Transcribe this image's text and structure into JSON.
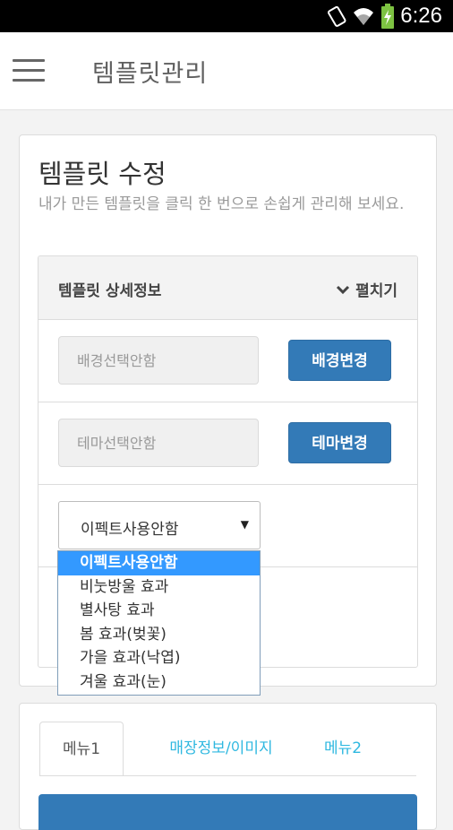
{
  "status_bar": {
    "time": "6:26",
    "icons": [
      "vibrate-icon",
      "wifi-icon",
      "battery-charging-icon"
    ]
  },
  "app_bar": {
    "menu_icon": "hamburger-menu-icon",
    "title": "템플릿관리"
  },
  "template_card": {
    "title": "템플릿 수정",
    "description": "내가 만든 템플릿을 클릭 한 번으로 손쉽게 관리해 보세요.",
    "panel": {
      "title": "템플릿 상세정보",
      "expand_label": "펼치기",
      "expand_icon": "chevron-down-icon",
      "background_field": "배경선택안함",
      "background_button": "배경변경",
      "theme_field": "테마선택안함",
      "theme_button": "테마변경",
      "effect_select": {
        "value": "이펙트사용안함",
        "options": [
          "이펙트사용안함",
          "비눗방울 효과",
          "별사탕 효과",
          "봄 효과(벚꽃)",
          "가을 효과(낙엽)",
          "겨울 효과(눈)"
        ],
        "selected_index": 0
      }
    }
  },
  "tabs_card": {
    "tabs": [
      "메뉴1",
      "매장정보/이미지",
      "메뉴2"
    ],
    "active_tab": 0
  },
  "colors": {
    "primary": "#337ab7",
    "link": "#2fb8e0",
    "dropdown_highlight": "#3399ff"
  }
}
